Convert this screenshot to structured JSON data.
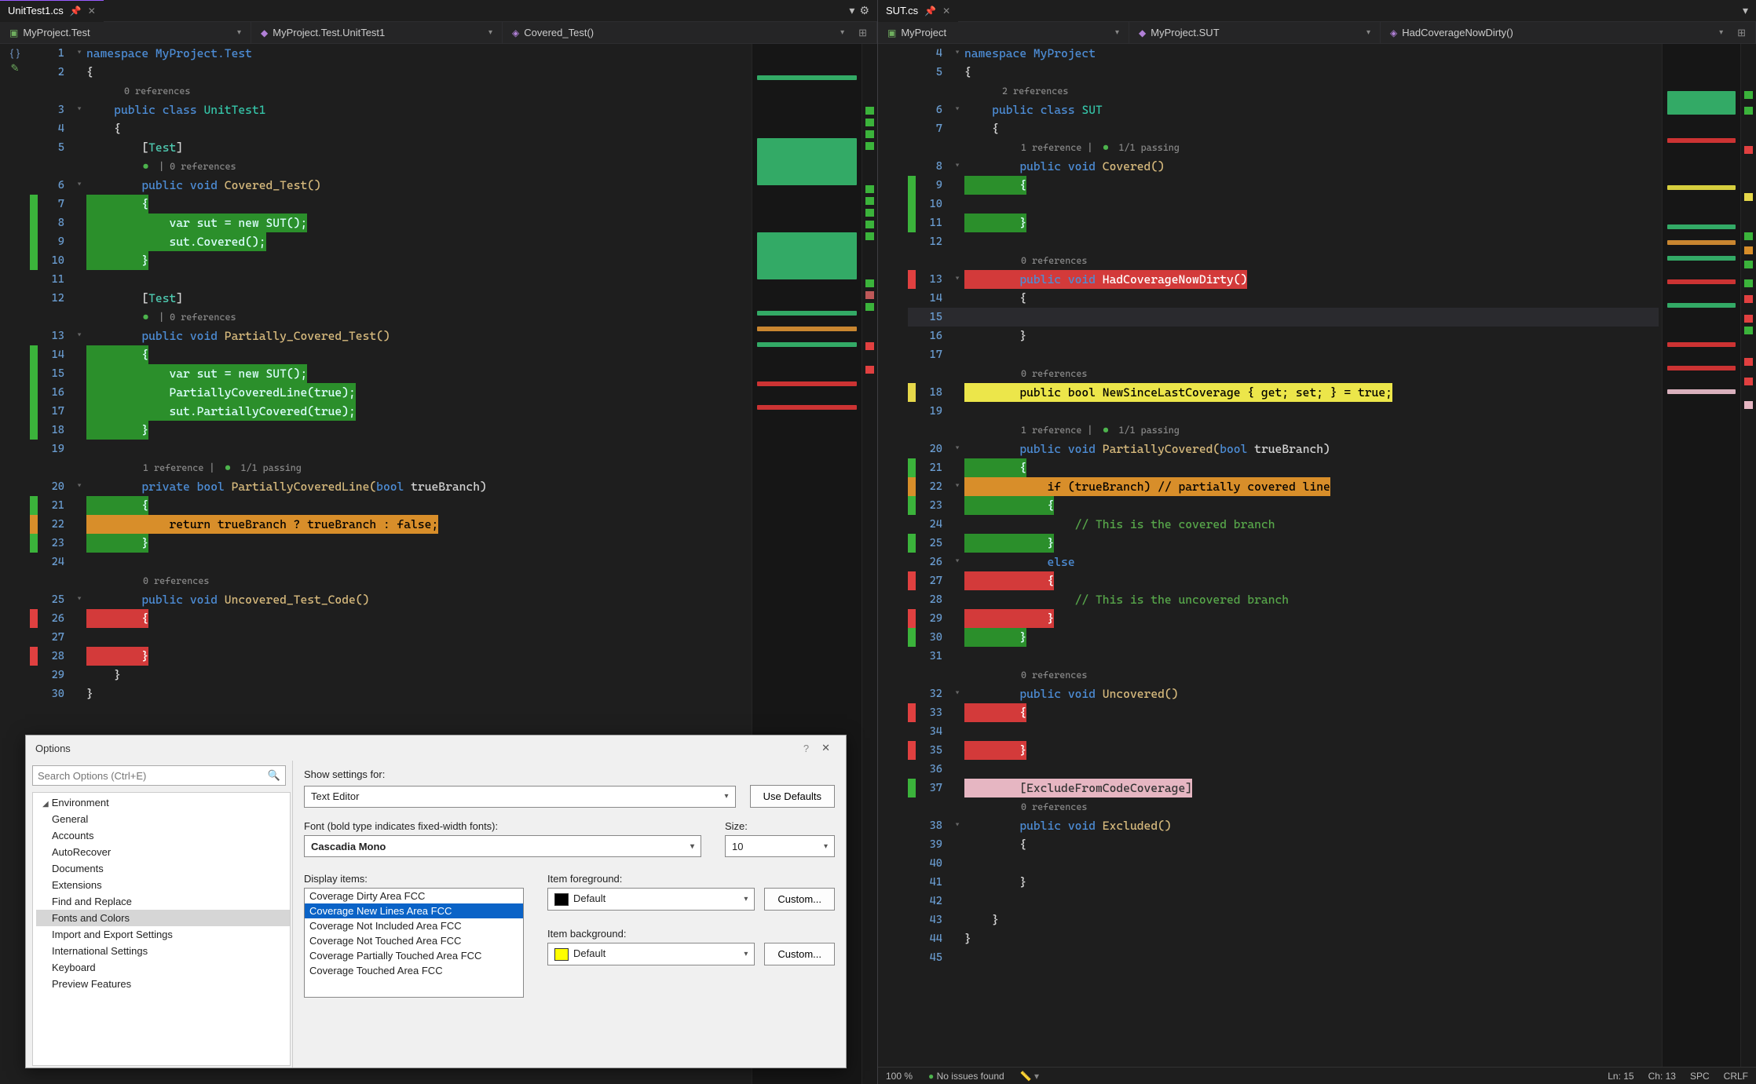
{
  "left": {
    "tab": {
      "title": "UnitTest1.cs"
    },
    "crumbs": {
      "project": "MyProject.Test",
      "type": "MyProject.Test.UnitTest1",
      "member": "Covered_Test()"
    },
    "lines": {
      "ns": "namespace MyProject.Test",
      "openBrace": "{",
      "lens0": "0 references",
      "classDecl_kw1": "public",
      "classDecl_kw2": "class",
      "classDecl_cls": "UnitTest1",
      "attrTest": "[Test]",
      "lensPass": " | 0 references",
      "mCovered_sig_kw1": "public",
      "mCovered_sig_kw2": "void",
      "mCovered_sig_name": "Covered_Test()",
      "brace_open": "{",
      "var_sut": "var sut = new SUT();",
      "sut_covered": "sut.Covered();",
      "brace_close": "}",
      "mPartial_sig_name": "Partially_Covered_Test()",
      "partial_line": "PartiallyCoveredLine(true);",
      "sut_partial": "sut.PartiallyCovered(true);",
      "lensP": "1 reference | ",
      "lensP2": " 1/1 passing",
      "mPrivBool_kw1": "private",
      "mPrivBool_kw2": "bool",
      "mPrivBool_name": "PartiallyCoveredLine(",
      "mPrivBool_kw3": "bool",
      "mPrivBool_arg": " trueBranch)",
      "ret_line": "return trueBranch ? trueBranch : false;",
      "mUncov_name": "Uncovered_Test_Code()"
    }
  },
  "right": {
    "tab": {
      "title": "SUT.cs"
    },
    "crumbs": {
      "project": "MyProject",
      "type": "MyProject.SUT",
      "member": "HadCoverageNowDirty()"
    },
    "lines": {
      "ns": "namespace MyProject",
      "openBrace": "{",
      "lens2": "2 references",
      "class_kw1": "public",
      "class_kw2": "class",
      "class_name": "SUT",
      "lens1p": "1 reference | ",
      "lens1pp": " 1/1 passing",
      "mCov_kw1": "public",
      "mCov_kw2": "void",
      "mCov_name": "Covered()",
      "lens0": "0 references",
      "mDirty_kw1": "public",
      "mDirty_kw2": "void",
      "mDirty_name": "HadCoverageNowDirty()",
      "newProp": "public bool NewSinceLastCoverage { get; set; } = true;",
      "mPart_kw1": "public",
      "mPart_kw2": "void",
      "mPart_name": "PartiallyCovered(",
      "mPart_kw3": "bool",
      "mPart_arg": " trueBranch)",
      "if_line": "if (trueBranch) // partially covered line",
      "cmt_cov": "// This is the covered branch",
      "else_kw": "else",
      "cmt_uncov": "// This is the uncovered branch",
      "mUncov_kw1": "public",
      "mUncov_kw2": "void",
      "mUncov_name": "Uncovered()",
      "excl_attr": "[ExcludeFromCodeCoverage]",
      "mExcl_kw1": "public",
      "mExcl_kw2": "void",
      "mExcl_name": "Excluded()"
    }
  },
  "options": {
    "title": "Options",
    "searchPlaceholder": "Search Options (Ctrl+E)",
    "tree": {
      "root": "Environment",
      "items": [
        "General",
        "Accounts",
        "AutoRecover",
        "Documents",
        "Extensions",
        "Find and Replace",
        "Fonts and Colors",
        "Import and Export Settings",
        "International Settings",
        "Keyboard",
        "Preview Features"
      ]
    },
    "showSettingsLabel": "Show settings for:",
    "showSettingsValue": "Text Editor",
    "useDefaults": "Use Defaults",
    "fontLabel": "Font (bold type indicates fixed-width fonts):",
    "fontValue": "Cascadia Mono",
    "sizeLabel": "Size:",
    "sizeValue": "10",
    "displayItemsLabel": "Display items:",
    "displayItems": [
      "Coverage Dirty Area FCC",
      "Coverage New Lines Area FCC",
      "Coverage Not Included Area FCC",
      "Coverage Not Touched Area FCC",
      "Coverage Partially Touched Area FCC",
      "Coverage Touched Area FCC"
    ],
    "displayItemsSelectedIndex": 1,
    "fgLabel": "Item foreground:",
    "fgValue": "Default",
    "bgLabel": "Item background:",
    "bgValue": "Default",
    "customBtn": "Custom..."
  },
  "status": {
    "zoom": "100 %",
    "issues": "No issues found",
    "ln": "Ln: 15",
    "ch": "Ch: 13",
    "spc": "SPC",
    "crlf": "CRLF"
  }
}
